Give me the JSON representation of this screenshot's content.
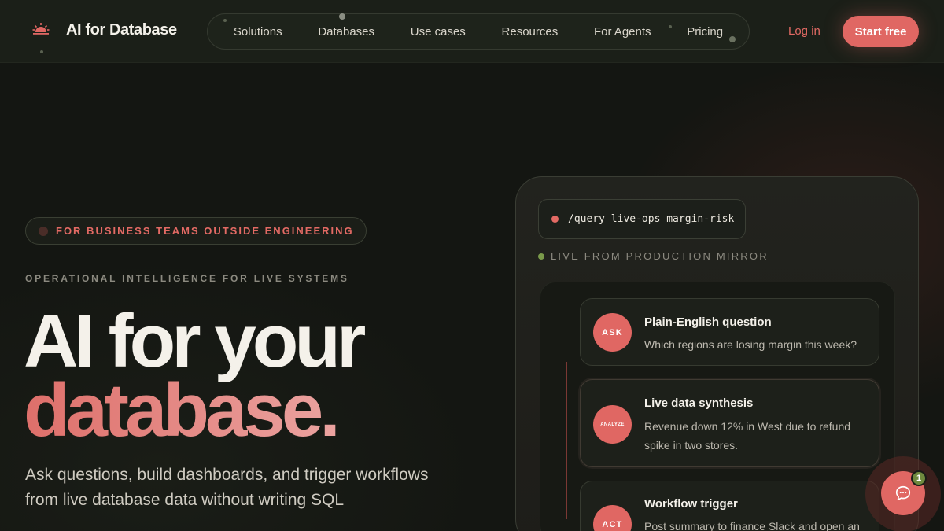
{
  "brand": {
    "name": "AI for Database",
    "icon": "sunrise-logo-icon"
  },
  "nav": {
    "items": [
      {
        "label": "Solutions"
      },
      {
        "label": "Databases"
      },
      {
        "label": "Use cases"
      },
      {
        "label": "Resources"
      },
      {
        "label": "For Agents"
      },
      {
        "label": "Pricing"
      }
    ],
    "login": "Log in",
    "cta": "Start free"
  },
  "hero": {
    "pill": "FOR BUSINESS TEAMS OUTSIDE ENGINEERING",
    "eyebrow": "OPERATIONAL INTELLIGENCE FOR LIVE SYSTEMS",
    "title_line1": "AI for your",
    "title_line2": "database.",
    "subtitle": "Ask questions, build dashboards, and trigger workflows from live database data without writing SQL"
  },
  "demo": {
    "query": "/query live-ops margin-risk",
    "status": "LIVE FROM PRODUCTION MIRROR",
    "steps": [
      {
        "badge": "ASK",
        "title": "Plain-English question",
        "body": "Which regions are losing margin this week?"
      },
      {
        "badge": "ANALYZE",
        "title": "Live data synthesis",
        "body": "Revenue down 12% in West due to refund spike in two stores."
      },
      {
        "badge": "ACT",
        "title": "Workflow trigger",
        "body": "Post summary to finance Slack and open an"
      }
    ]
  },
  "chat": {
    "unread": "1",
    "icon": "chat-bubble-icon"
  },
  "colors": {
    "accent": "#e06763",
    "background": "#141612",
    "live": "#7a9a4a"
  }
}
